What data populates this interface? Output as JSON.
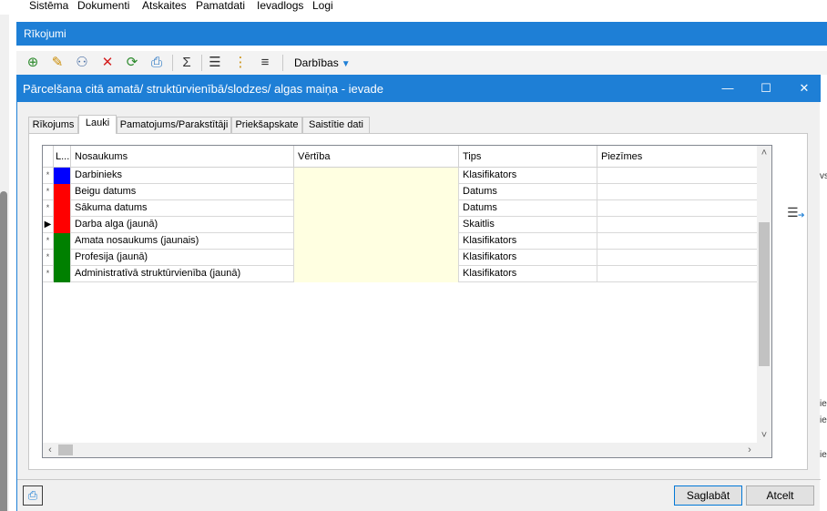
{
  "menu": {
    "items": [
      "Sistēma",
      "Dokumenti",
      "Atskaites",
      "Pamatdati",
      "Ievadlogs",
      "Logi"
    ]
  },
  "module": {
    "title": "Rīkojumi"
  },
  "toolbar": {
    "buttons": [
      {
        "name": "add-icon",
        "glyph": "⊕",
        "color": "#2e8b2e"
      },
      {
        "name": "edit-icon",
        "glyph": "✎",
        "color": "#c98a00"
      },
      {
        "name": "view-icon",
        "glyph": "⚇",
        "color": "#4a6fa5"
      },
      {
        "name": "delete-icon",
        "glyph": "✕",
        "color": "#d42020"
      },
      {
        "name": "refresh-icon",
        "glyph": "⟳",
        "color": "#2e8b2e"
      },
      {
        "name": "print-icon",
        "glyph": "⎙",
        "color": "#1e6fc0"
      },
      {
        "name": "sum-icon",
        "glyph": "Σ",
        "color": "#333333"
      },
      {
        "name": "list-icon",
        "glyph": "☰",
        "color": "#333333"
      },
      {
        "name": "tree-icon",
        "glyph": "⋮",
        "color": "#c98a00"
      },
      {
        "name": "indent-icon",
        "glyph": "≡",
        "color": "#333333"
      }
    ],
    "actions_label": "Darbības"
  },
  "dialog": {
    "title": "Pārcelšana citā amatā/ struktūrvienībā/slodzes/ algas maiņa - ievade",
    "window_buttons": {
      "minimize": "—",
      "maximize": "☐",
      "close": "✕"
    },
    "tabs": [
      {
        "label": "Rīkojums"
      },
      {
        "label": "Lauki",
        "active": true
      },
      {
        "label": "Pamatojums/Parakstītāji"
      },
      {
        "label": "Priekšapskate"
      },
      {
        "label": "Saistītie dati"
      }
    ],
    "grid": {
      "columns": [
        "L...",
        "Nosaukums",
        "Vērtība",
        "Tips",
        "Piezīmes"
      ],
      "rows": [
        {
          "indicator": "*",
          "color": "#0000ff",
          "name": "Darbinieks",
          "value": "",
          "type": "Klasifikators",
          "notes": ""
        },
        {
          "indicator": "*",
          "color": "#ff0000",
          "name": "Beigu datums",
          "value": "",
          "type": "Datums",
          "notes": ""
        },
        {
          "indicator": "*",
          "color": "#ff0000",
          "name": "Sākuma datums",
          "value": "",
          "type": "Datums",
          "notes": ""
        },
        {
          "indicator": "▶",
          "color": "#ff0000",
          "name": "Darba alga (jaunā)",
          "value": "",
          "type": "Skaitlis",
          "notes": ""
        },
        {
          "indicator": "*",
          "color": "#008000",
          "name": "Amata nosaukums (jaunais)",
          "value": "",
          "type": "Klasifikators",
          "notes": ""
        },
        {
          "indicator": "*",
          "color": "#008000",
          "name": "Profesija (jaunā)",
          "value": "",
          "type": "Klasifikators",
          "notes": ""
        },
        {
          "indicator": "*",
          "color": "#008000",
          "name": "Administratīvā struktūrvienība (jaunā)",
          "value": "",
          "type": "Klasifikators",
          "notes": ""
        }
      ]
    },
    "buttons": {
      "save": "Saglabāt",
      "cancel": "Atcelt"
    }
  },
  "background_fragments": [
    "vs",
    "ie",
    "ie",
    "ie"
  ],
  "colors": {
    "accent": "#1e7fd6",
    "value_cell": "#ffffe1"
  }
}
